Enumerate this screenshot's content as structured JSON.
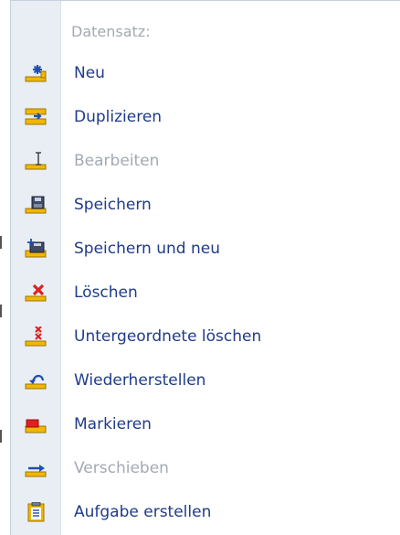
{
  "menu": {
    "header": "Datensatz:",
    "items": [
      {
        "label": "Neu",
        "icon": "new-record-icon",
        "enabled": true
      },
      {
        "label": "Duplizieren",
        "icon": "duplicate-icon",
        "enabled": true
      },
      {
        "label": "Bearbeiten",
        "icon": "edit-icon",
        "enabled": false
      },
      {
        "label": "Speichern",
        "icon": "save-icon",
        "enabled": true
      },
      {
        "label": "Speichern und neu",
        "icon": "save-and-new-icon",
        "enabled": true
      },
      {
        "label": "Löschen",
        "icon": "delete-icon",
        "enabled": true
      },
      {
        "label": "Untergeordnete löschen",
        "icon": "delete-children-icon",
        "enabled": true
      },
      {
        "label": "Wiederherstellen",
        "icon": "restore-icon",
        "enabled": true
      },
      {
        "label": "Markieren",
        "icon": "mark-icon",
        "enabled": true
      },
      {
        "label": "Verschieben",
        "icon": "move-icon",
        "enabled": false
      },
      {
        "label": "Aufgabe erstellen",
        "icon": "create-task-icon",
        "enabled": true
      }
    ]
  },
  "colors": {
    "label": "#1f3b8a",
    "disabled": "#a3a9b3",
    "gutter": "#e9eef5",
    "tray": "#f2b705",
    "delete": "#e02020"
  }
}
